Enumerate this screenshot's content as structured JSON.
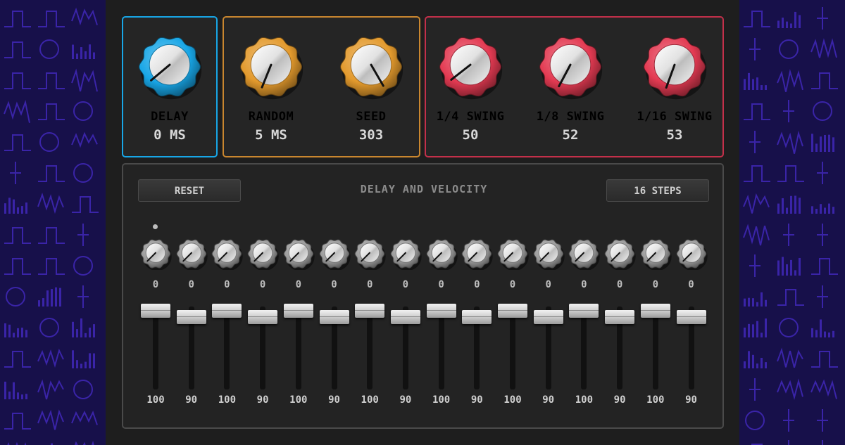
{
  "colors": {
    "delay": "#18a6e6",
    "random": "#e39a2d",
    "swing": "#e33a52",
    "background": "#17104a",
    "device": "#1e1e1e"
  },
  "knobs": [
    {
      "id": "delay",
      "label": "DELAY",
      "value": "0 MS",
      "group": "delay",
      "angle": 220
    },
    {
      "id": "random",
      "label": "RANDOM",
      "value": "5 MS",
      "group": "random",
      "angle": 248
    },
    {
      "id": "seed",
      "label": "SEED",
      "value": "303",
      "group": "random",
      "angle": 300
    },
    {
      "id": "swing4",
      "label": "1/4 SWING",
      "value": "50",
      "group": "swing",
      "angle": 218
    },
    {
      "id": "swing8",
      "label": "1/8 SWING",
      "value": "52",
      "group": "swing",
      "angle": 242
    },
    {
      "id": "swing16",
      "label": "1/16 SWING",
      "value": "53",
      "group": "swing",
      "angle": 250
    }
  ],
  "sequencer": {
    "title": "DELAY AND VELOCITY",
    "reset_label": "RESET",
    "steps_label": "16 STEPS",
    "active_step": 0,
    "delays": [
      "0",
      "0",
      "0",
      "0",
      "0",
      "0",
      "0",
      "0",
      "0",
      "0",
      "0",
      "0",
      "0",
      "0",
      "0",
      "0"
    ],
    "velocities": [
      "100",
      "90",
      "100",
      "90",
      "100",
      "90",
      "100",
      "90",
      "100",
      "90",
      "100",
      "90",
      "100",
      "90",
      "100",
      "90"
    ],
    "velocity_levels": [
      100,
      90,
      100,
      90,
      100,
      90,
      100,
      90,
      100,
      90,
      100,
      90,
      100,
      90,
      100,
      90
    ]
  }
}
